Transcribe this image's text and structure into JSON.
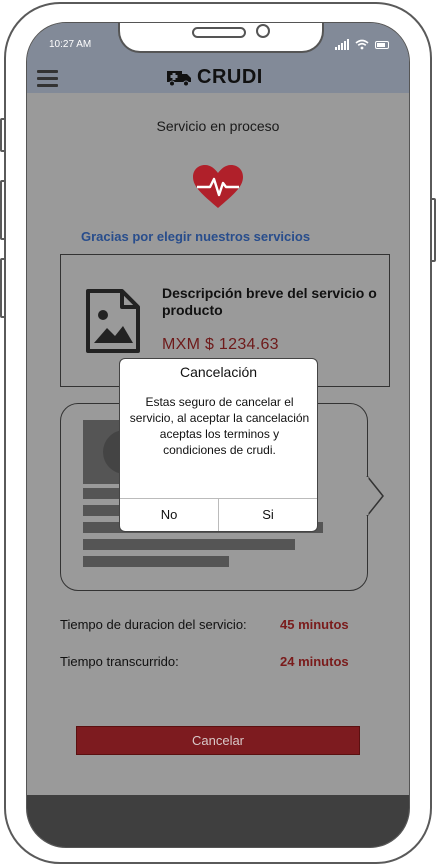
{
  "status": {
    "time": "10:27 AM"
  },
  "header": {
    "brand": "CRUDI"
  },
  "page": {
    "title": "Servicio en proceso",
    "thanks": "Gracias por elegir nuestros servicios"
  },
  "service": {
    "description": "Descripción breve del servicio o producto",
    "price": "MXM $ 1234.63"
  },
  "details": {
    "duration_label": "Tiempo de duracion del servicio:",
    "duration_value": "45 minutos",
    "elapsed_label": "Tiempo transcurrido:",
    "elapsed_value": "24 minutos"
  },
  "actions": {
    "cancel_label": "Cancelar"
  },
  "modal": {
    "title": "Cancelación",
    "body": "Estas seguro de cancelar el servicio, al aceptar la cancelación aceptas los terminos y condiciones de crudi.",
    "no_label": "No",
    "yes_label": "Si"
  },
  "icons": {
    "menu": "hamburger-menu-icon",
    "brand": "ambulance-icon",
    "heart": "heart-pulse-icon",
    "document": "image-document-icon",
    "signal": "signal-icon",
    "wifi": "wifi-icon",
    "battery": "battery-icon"
  },
  "colors": {
    "accent": "#7d1b1f",
    "link": "#284d8c",
    "heart": "#b0202a"
  }
}
